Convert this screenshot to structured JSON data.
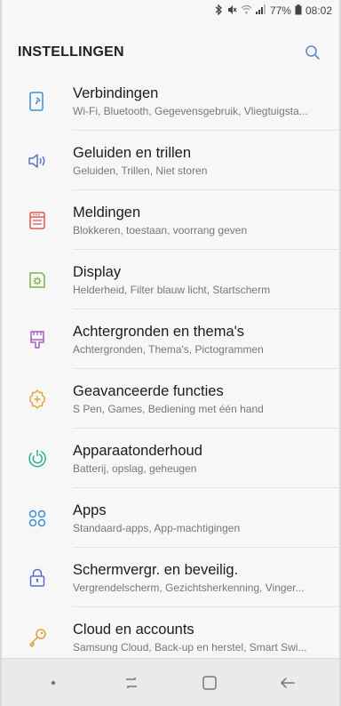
{
  "status_bar": {
    "icons": [
      "bluetooth-icon",
      "mute-icon",
      "wifi-icon",
      "signal-icon"
    ],
    "battery": "77%",
    "battery_icon": "battery-icon",
    "time": "08:02"
  },
  "header": {
    "title": "INSTELLINGEN",
    "search_icon": "search-icon"
  },
  "colors": {
    "accent": "#5b8ec9",
    "connections": "#3a8fd6",
    "sounds": "#5b74c9",
    "notifications": "#e05a4b",
    "display": "#7ab648",
    "wallpapers": "#a45fc4",
    "advanced": "#e8a33b",
    "maintenance": "#2fae9b",
    "apps": "#3a8fd6",
    "security": "#5b6cc9",
    "cloud": "#e59c3f"
  },
  "items": [
    {
      "label": "Verbindingen",
      "sub": "Wi-Fi, Bluetooth, Gegevensgebruik, Vliegtuigsta...",
      "icon": "connections-icon"
    },
    {
      "label": "Geluiden en trillen",
      "sub": "Geluiden, Trillen, Niet storen",
      "icon": "speaker-icon"
    },
    {
      "label": "Meldingen",
      "sub": "Blokkeren, toestaan, voorrang geven",
      "icon": "notifications-icon"
    },
    {
      "label": "Display",
      "sub": "Helderheid, Filter blauw licht, Startscherm",
      "icon": "display-icon"
    },
    {
      "label": "Achtergronden en thema's",
      "sub": "Achtergronden, Thema's, Pictogrammen",
      "icon": "brush-icon"
    },
    {
      "label": "Geavanceerde functies",
      "sub": "S Pen, Games, Bediening met één hand",
      "icon": "gear-plus-icon"
    },
    {
      "label": "Apparaatonderhoud",
      "sub": "Batterij, opslag, geheugen",
      "icon": "device-care-icon"
    },
    {
      "label": "Apps",
      "sub": "Standaard-apps, App-machtigingen",
      "icon": "apps-icon"
    },
    {
      "label": "Schermvergr. en beveilig.",
      "sub": "Vergrendelscherm, Gezichtsherkenning, Vinger...",
      "icon": "lock-icon"
    },
    {
      "label": "Cloud en accounts",
      "sub": "Samsung Cloud, Back-up en herstel, Smart Swi...",
      "icon": "key-icon"
    }
  ],
  "navbar": {
    "buttons": [
      "dot-icon",
      "recent-apps-icon",
      "home-icon",
      "back-icon"
    ]
  }
}
